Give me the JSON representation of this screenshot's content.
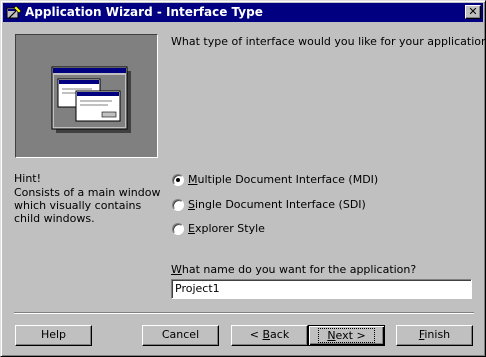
{
  "window": {
    "title": "Application Wizard - Interface Type",
    "close_label": "✕"
  },
  "question": "What type of interface would you like for your application?",
  "hint": {
    "title": "Hint!",
    "body": "Consists of a main window which visually contains child windows."
  },
  "interface_options": [
    {
      "mnemonic": "M",
      "rest": "ultiple Document Interface (MDI)",
      "selected": true
    },
    {
      "mnemonic": "S",
      "rest": "ingle Document Interface (SDI)",
      "selected": false
    },
    {
      "mnemonic": "E",
      "rest": "xplorer Style",
      "selected": false
    }
  ],
  "name_field": {
    "label_mnemonic": "W",
    "label_rest": "hat name do you want for the application?",
    "value": "Project1"
  },
  "buttons": {
    "help": "Help",
    "cancel": "Cancel",
    "back_prefix": "< ",
    "back_mnemonic": "B",
    "back_rest": "ack",
    "next_mnemonic": "N",
    "next_rest": "ext >",
    "finish_mnemonic": "F",
    "finish_rest": "inish"
  },
  "colors": {
    "titlebar": "#000080",
    "face": "#c0c0c0",
    "preview_bg": "#808080"
  },
  "icons": {
    "title_icon": "wizard-app-icon",
    "preview": "mdi-windows-illustration"
  }
}
